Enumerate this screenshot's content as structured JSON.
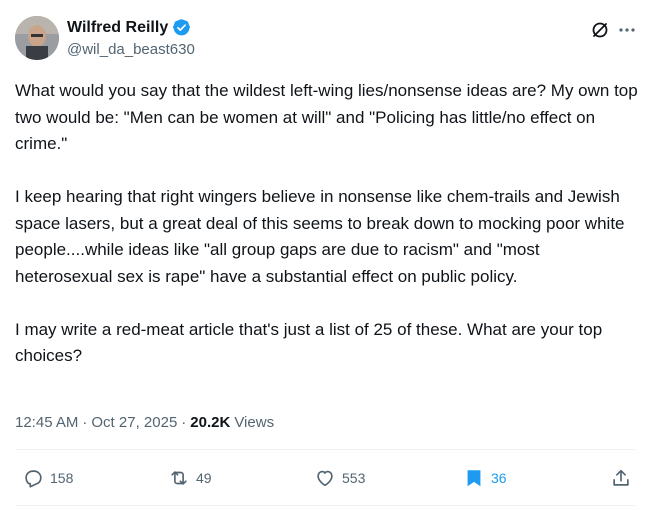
{
  "author": {
    "display_name": "Wilfred Reilly",
    "handle": "@wil_da_beast630",
    "verified": true
  },
  "tweet": {
    "paragraphs": [
      "What would you say that the wildest left-wing lies/nonsense ideas are? My own top two would be: \"Men can be women at will\" and \"Policing has little/no effect on crime.\"",
      "I keep hearing that right wingers believe in nonsense like chem-trails and Jewish space lasers, but a great deal of this seems to break down to mocking poor white people....while ideas like \"all group gaps are due to racism\" and \"most heterosexual sex is rape\" have a substantial effect on public policy.",
      "I may write a red-meat article that's just a list of 25 of these. What are your top choices?"
    ],
    "time": "12:45 AM",
    "date": "Oct 27, 2025",
    "separator": "·",
    "views_count": "20.2K",
    "views_label": "Views"
  },
  "actions": {
    "reply_count": "158",
    "repost_count": "49",
    "like_count": "553",
    "bookmark_count": "36"
  },
  "colors": {
    "accent": "#1d9bf0",
    "text": "#0f1419",
    "muted": "#536471"
  },
  "icons": [
    "verified-badge-icon",
    "grok-icon",
    "more-icon",
    "reply-icon",
    "repost-icon",
    "like-icon",
    "bookmark-icon",
    "share-icon"
  ]
}
